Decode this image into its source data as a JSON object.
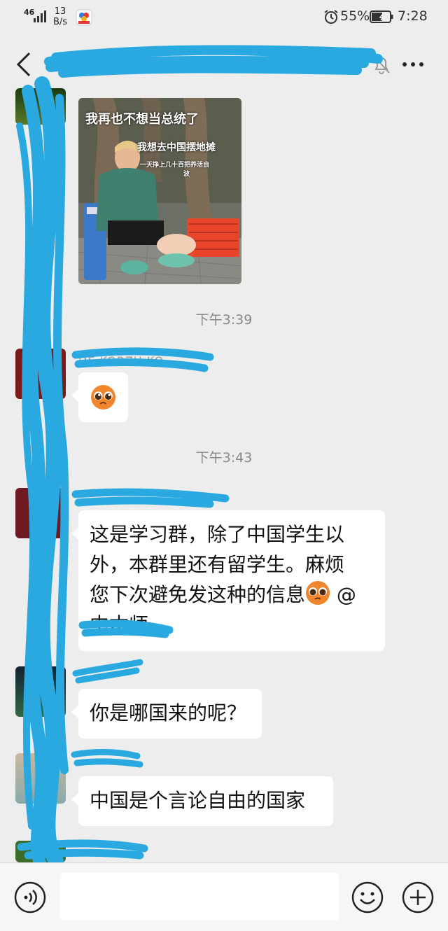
{
  "status_bar": {
    "network": "46",
    "speed_value": "13",
    "speed_unit": "B/s",
    "battery_percent": "55%",
    "time": "7:28",
    "icons": [
      "signal-bars-icon",
      "app-notification-icon",
      "alarm-icon",
      "battery-icon"
    ]
  },
  "header": {
    "title": "",
    "icons": [
      "back-arrow-icon",
      "mute-bell-icon",
      "more-dots-icon"
    ]
  },
  "messages": [
    {
      "type": "image",
      "captions": [
        "我再也不想当总统了",
        "我想去中国摆地摊",
        "一天挣上几十百把养活自",
        "波"
      ]
    },
    {
      "type": "timestamp",
      "text": "下午3:39"
    },
    {
      "type": "emoji",
      "sender": "DE     KORZH   KO",
      "emoji": "pleading-face-emoji"
    },
    {
      "type": "timestamp",
      "text": "下午3:43"
    },
    {
      "type": "text",
      "sender": "",
      "lines": [
        "这是学习群，除了中国学生以",
        "外，本群里还有留学生。麻烦",
        "您下次避免发这种的信息",
        " @",
        "中本师"
      ]
    },
    {
      "type": "text",
      "sender": "",
      "text": "你是哪国来的呢？"
    },
    {
      "type": "text",
      "sender": "",
      "text": "中国是个言论自由的国家"
    }
  ],
  "input_bar": {
    "placeholder": "",
    "icons": [
      "voice-icon",
      "emoji-smiley-icon",
      "plus-icon"
    ]
  },
  "colors": {
    "background": "#ededed",
    "bubble": "#ffffff",
    "input_bar": "#f6f6f6",
    "redaction_scribble": "#29a9e0",
    "timestamp_text": "#888888"
  }
}
